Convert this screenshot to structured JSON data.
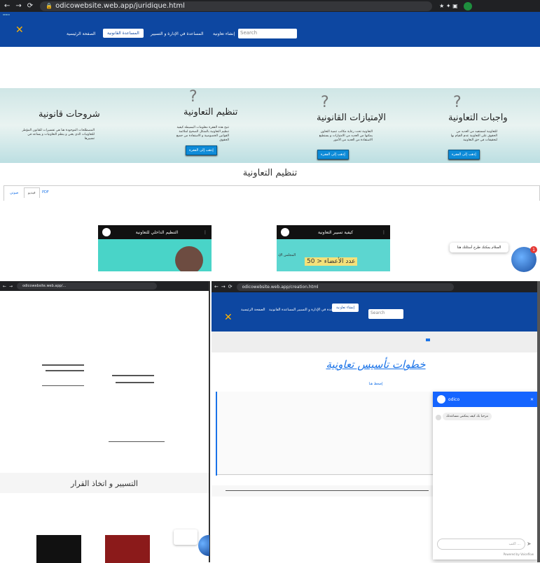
{
  "top_browser": {
    "url": "odicowebsite.web.app/juridique.html"
  },
  "top_nav": {
    "links": [
      "الصفحة الرئيسية",
      "المساعدة القانونية",
      "المساعدة في الإدارة و التسيير",
      "إنشاء تعاونية"
    ],
    "search_placeholder": "Search"
  },
  "hero": {
    "cards": [
      {
        "title": "شروحات قانونية",
        "text": "المصطلحات الموجودة هنا هي تفسيرات للقانون المؤطر للتعاونيات الذي يعني و ينظم التعاونيات و يساعد في تسييرها"
      },
      {
        "title": "تنظيم التعاونية",
        "text": "تتيح هذه الفقرة معلومات البسيطة كيفية تنظيم التعاونية بالشكل الصحيح لملائمة القوانين الخصوصية و الاستفادة من جميع الحقوق",
        "btn": "إذهب إلى الفقرة"
      },
      {
        "title": "الإمتيازات القانونية",
        "text": "التعاونية تحت رعاية مكاتب تنمية التعاون يمكنها من العديد من الامتيازات و يستطيع الاستفادة من العديد من الأمور",
        "btn": "إذهب إلى الفقرة"
      },
      {
        "title": "واجبات التعاونية",
        "text": "للتعاونية لمستفيد من العديد من الحقوق على التعاونية عدم القيام بها لتحقيقات في حق التعاونية",
        "btn": "إذهب إلى الفقرة"
      }
    ]
  },
  "section": {
    "title": "تنظيم التعاونية",
    "tabs": [
      "صوتي",
      "فيديو",
      "PDF"
    ]
  },
  "videos": [
    {
      "title": "التنظيم الداخلي للتعاونية"
    },
    {
      "title": "كيفية تسيير التعاونية",
      "overlay": "عدد الأعضاء < 50",
      "side": "المجلس الإد"
    }
  ],
  "chat_widget": {
    "message": "السلام يمكنك طرح أسئلتك هنا",
    "badge": "1"
  },
  "left_browser": {
    "url": "odicowebsite.web.app/..."
  },
  "left_section_title": "التسيير و اتخاذ القرار",
  "right_browser": {
    "url": "odicowebsite.web.app/creation.html"
  },
  "right_nav": {
    "links": [
      "إنشاء تعاونية",
      "المساعدة في الإدارة و التسيير",
      "المساعدة القانونية",
      "الصفحة الرئيسية"
    ],
    "search_placeholder": "Search"
  },
  "right_page": {
    "title": "خطوات تأسيس تعاونية",
    "link": "إضغط هنا"
  },
  "chat_panel": {
    "header": "odico",
    "bot_message": "مرحبا بك كيف يمكنني مساعدتك",
    "input_placeholder": "اكتب ...",
    "footer": "Powered by Voiceflow"
  },
  "colors": {
    "nav": "#0d47a1",
    "accent": "#0e8bd8"
  }
}
